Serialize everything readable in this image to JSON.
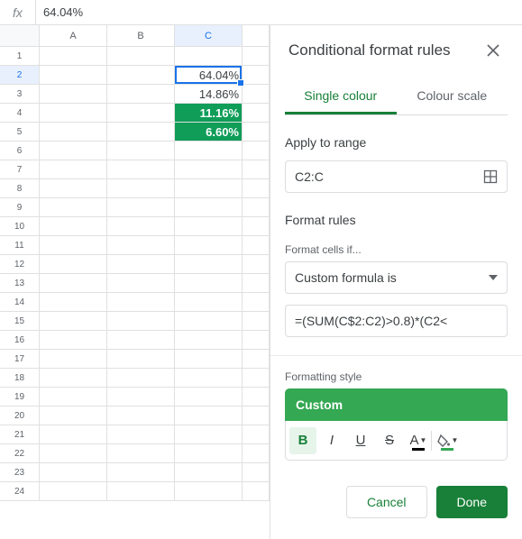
{
  "formula_bar": {
    "fx_label": "fx",
    "value": "64.04%"
  },
  "grid": {
    "columns": [
      "A",
      "B",
      "C"
    ],
    "rows": 24,
    "active_cell": {
      "row": 2,
      "col": "C"
    },
    "cells": {
      "C2": {
        "value": "64.04%",
        "highlight": false
      },
      "C3": {
        "value": "14.86%",
        "highlight": false
      },
      "C4": {
        "value": "11.16%",
        "highlight": true
      },
      "C5": {
        "value": "6.60%",
        "highlight": true
      }
    }
  },
  "panel": {
    "title": "Conditional format rules",
    "tabs": {
      "single": "Single colour",
      "scale": "Colour scale",
      "active": "single"
    },
    "apply_range": {
      "label": "Apply to range",
      "value": "C2:C"
    },
    "format_rules": {
      "label": "Format rules",
      "condition_label": "Format cells if...",
      "condition_value": "Custom formula is",
      "formula_value": "=(SUM(C$2:C2)>0.8)*(C2<"
    },
    "style": {
      "label": "Formatting style",
      "chip": "Custom"
    },
    "buttons": {
      "cancel": "Cancel",
      "done": "Done"
    },
    "toolbar_icons": {
      "bold": "B",
      "italic": "I",
      "underline": "U",
      "strike": "S",
      "text_color": "A"
    },
    "colors": {
      "accent": "#34a853",
      "accent_dark": "#188038"
    }
  }
}
